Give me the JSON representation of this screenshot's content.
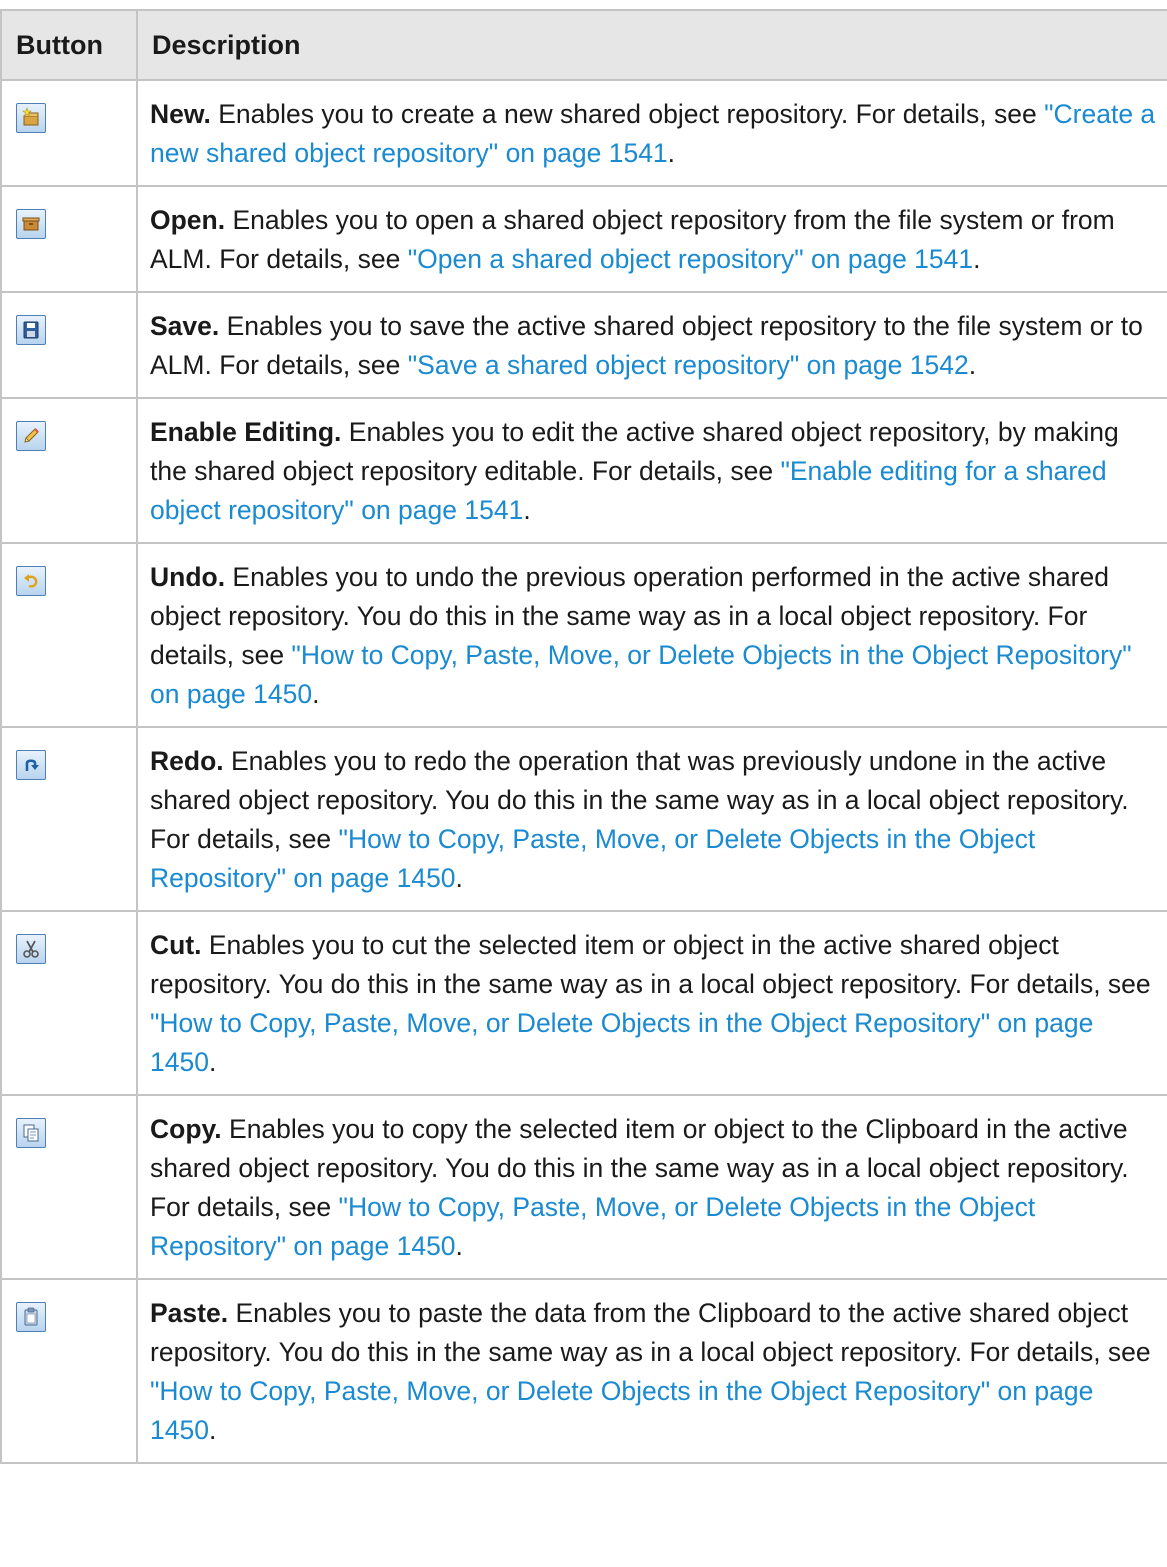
{
  "header": {
    "button": "Button",
    "description": "Description"
  },
  "rows": [
    {
      "icon": "new-icon",
      "term": "New.",
      "text": " Enables you to create a new shared object repository. For details, see ",
      "link": "\"Create a new shared object repository\" on page 1541",
      "end": "."
    },
    {
      "icon": "open-icon",
      "term": "Open.",
      "text": " Enables you to open a shared object repository from the file system or from ALM. For details, see ",
      "link": "\"Open a shared object repository\" on page 1541",
      "end": "."
    },
    {
      "icon": "save-icon",
      "term": "Save.",
      "text": " Enables you to save the active shared object repository to the file system or to ALM. For details, see ",
      "link": "\"Save a shared object repository\" on page 1542",
      "end": "."
    },
    {
      "icon": "pencil-icon",
      "term": "Enable Editing.",
      "text": " Enables you to edit the active shared object repository, by making the shared object repository editable. For details, see ",
      "link": "\"Enable editing for a shared object repository\" on page 1541",
      "end": "."
    },
    {
      "icon": "undo-icon",
      "term": "Undo.",
      "text": " Enables you to undo the previous operation performed in the active shared object repository. You do this in the same way as in a local object repository. For details, see ",
      "link": "\"How to Copy, Paste, Move, or Delete Objects in the Object Repository\" on page 1450",
      "end": "."
    },
    {
      "icon": "redo-icon",
      "term": "Redo.",
      "text": " Enables you to redo the operation that was previously undone in the active shared object repository. You do this in the same way as in a local object repository. For details, see ",
      "link": "\"How to Copy, Paste, Move, or Delete Objects in the Object Repository\" on page 1450",
      "end": "."
    },
    {
      "icon": "scissors-icon",
      "term": "Cut.",
      "text": " Enables you to cut the selected item or object in the active shared object repository. You do this in the same way as in a local object repository. For details, see ",
      "link": "\"How to Copy, Paste, Move, or Delete Objects in the Object Repository\" on page 1450",
      "end": "."
    },
    {
      "icon": "copy-icon",
      "term": "Copy.",
      "text": " Enables you to copy the selected item or object to the Clipboard in the active shared object repository. You do this in the same way as in a local object repository. For details, see ",
      "link": "\"How to Copy, Paste, Move, or Delete Objects in the Object Repository\" on page 1450",
      "end": "."
    },
    {
      "icon": "paste-icon",
      "term": "Paste.",
      "text": " Enables you to paste the data from the Clipboard to the active shared object repository. You do this in the same way as in a local object repository. For details, see ",
      "link": "\"How to Copy, Paste, Move, or Delete Objects in the Object Repository\" on page 1450",
      "end": "."
    }
  ]
}
